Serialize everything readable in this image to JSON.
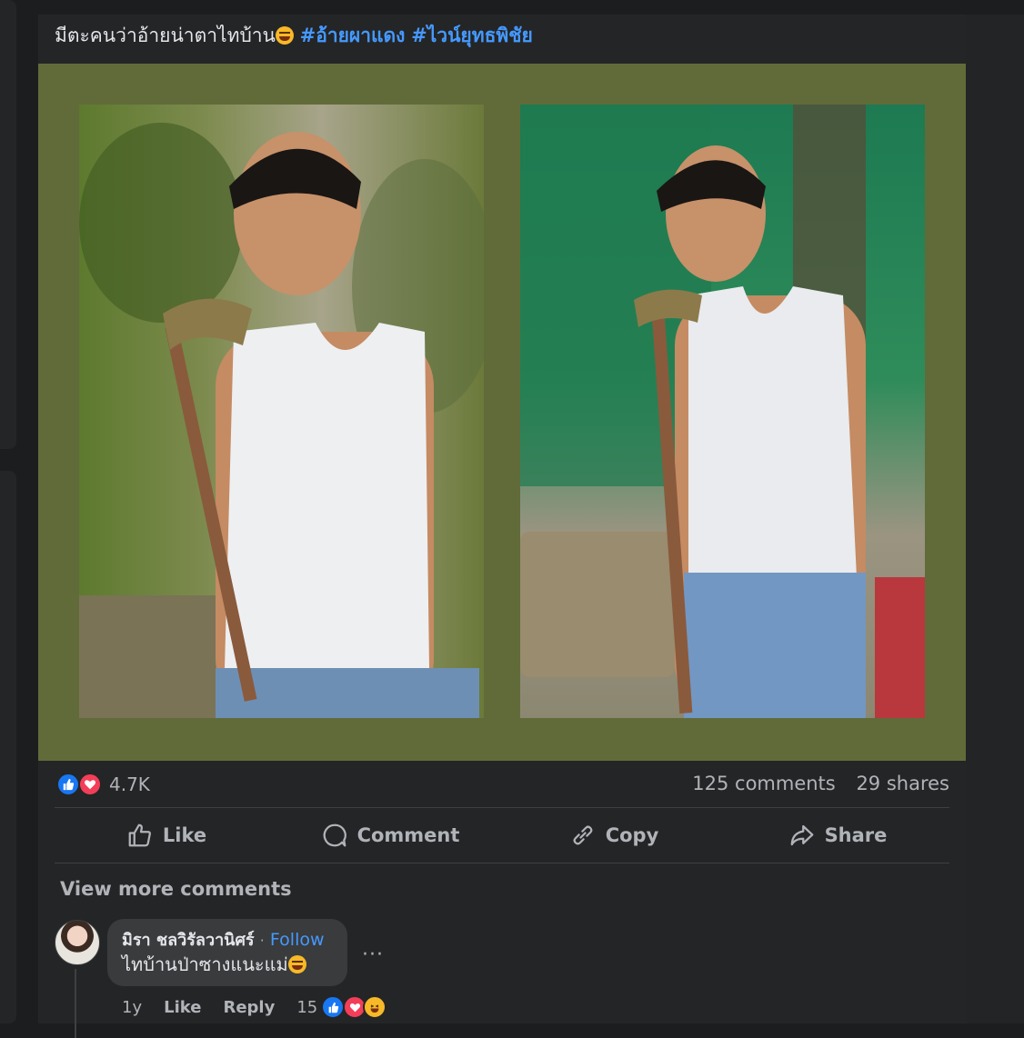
{
  "post": {
    "caption": "มีตะคนว่าอ้ายน่าตาไทบ้าน",
    "caption_emoji": "rolling-on-floor-laughing",
    "hashtags": [
      "#อ้ายผาแดง",
      "#ไวน์ยุทธพิชัย"
    ],
    "media_background": "#616b39"
  },
  "stats": {
    "reaction_icons": [
      "like",
      "love"
    ],
    "reaction_count": "4.7K",
    "comments": "125 comments",
    "shares": "29 shares"
  },
  "actions": {
    "like": "Like",
    "comment": "Comment",
    "copy": "Copy",
    "share": "Share"
  },
  "comments_section": {
    "view_more": "View more comments",
    "comment": {
      "author": "มิรา ชลวิรัลวานิศร์",
      "separator": "·",
      "follow": "Follow",
      "text": "ไทบ้านป่าซางแนะแม่",
      "text_emoji": "rolling-on-floor-laughing",
      "more": "···",
      "age": "1y",
      "like": "Like",
      "reply": "Reply",
      "reaction_count": "15",
      "reaction_icons": [
        "like",
        "love",
        "haha"
      ]
    }
  },
  "colors": {
    "background": "#1c1d1f",
    "card": "#242526",
    "link": "#4599ff",
    "like": "#1877f2",
    "love": "#f33e58",
    "haha": "#f7b928"
  }
}
